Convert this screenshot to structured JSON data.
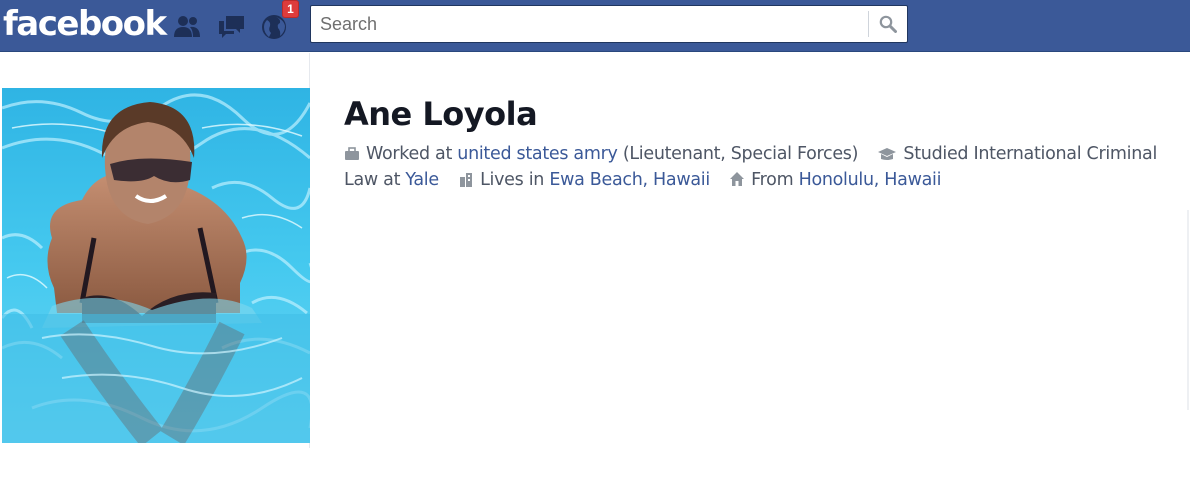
{
  "header": {
    "logo": "facebook",
    "notification_count": "1",
    "search": {
      "placeholder": "Search",
      "value": ""
    }
  },
  "profile": {
    "name": "Ane Loyola",
    "work": {
      "prefix": "Worked at",
      "employer": "united states amry",
      "role": "(Lieutenant, Special Forces)"
    },
    "education": {
      "prefix": "Studied International Criminal Law at",
      "school": "Yale"
    },
    "residence": {
      "prefix": "Lives in",
      "place": "Ewa Beach, Hawaii"
    },
    "hometown": {
      "prefix": "From",
      "place": "Honolulu, Hawaii"
    }
  },
  "icons": [
    "friend-requests-icon",
    "messages-icon",
    "notifications-globe-icon",
    "search-icon",
    "briefcase-icon",
    "graduation-cap-icon",
    "city-icon",
    "house-icon"
  ],
  "colors": {
    "header_bg": "#3b5998",
    "link": "#3b5998",
    "badge": "#dd3c3c",
    "text": "#4e5665",
    "name": "#141823"
  }
}
